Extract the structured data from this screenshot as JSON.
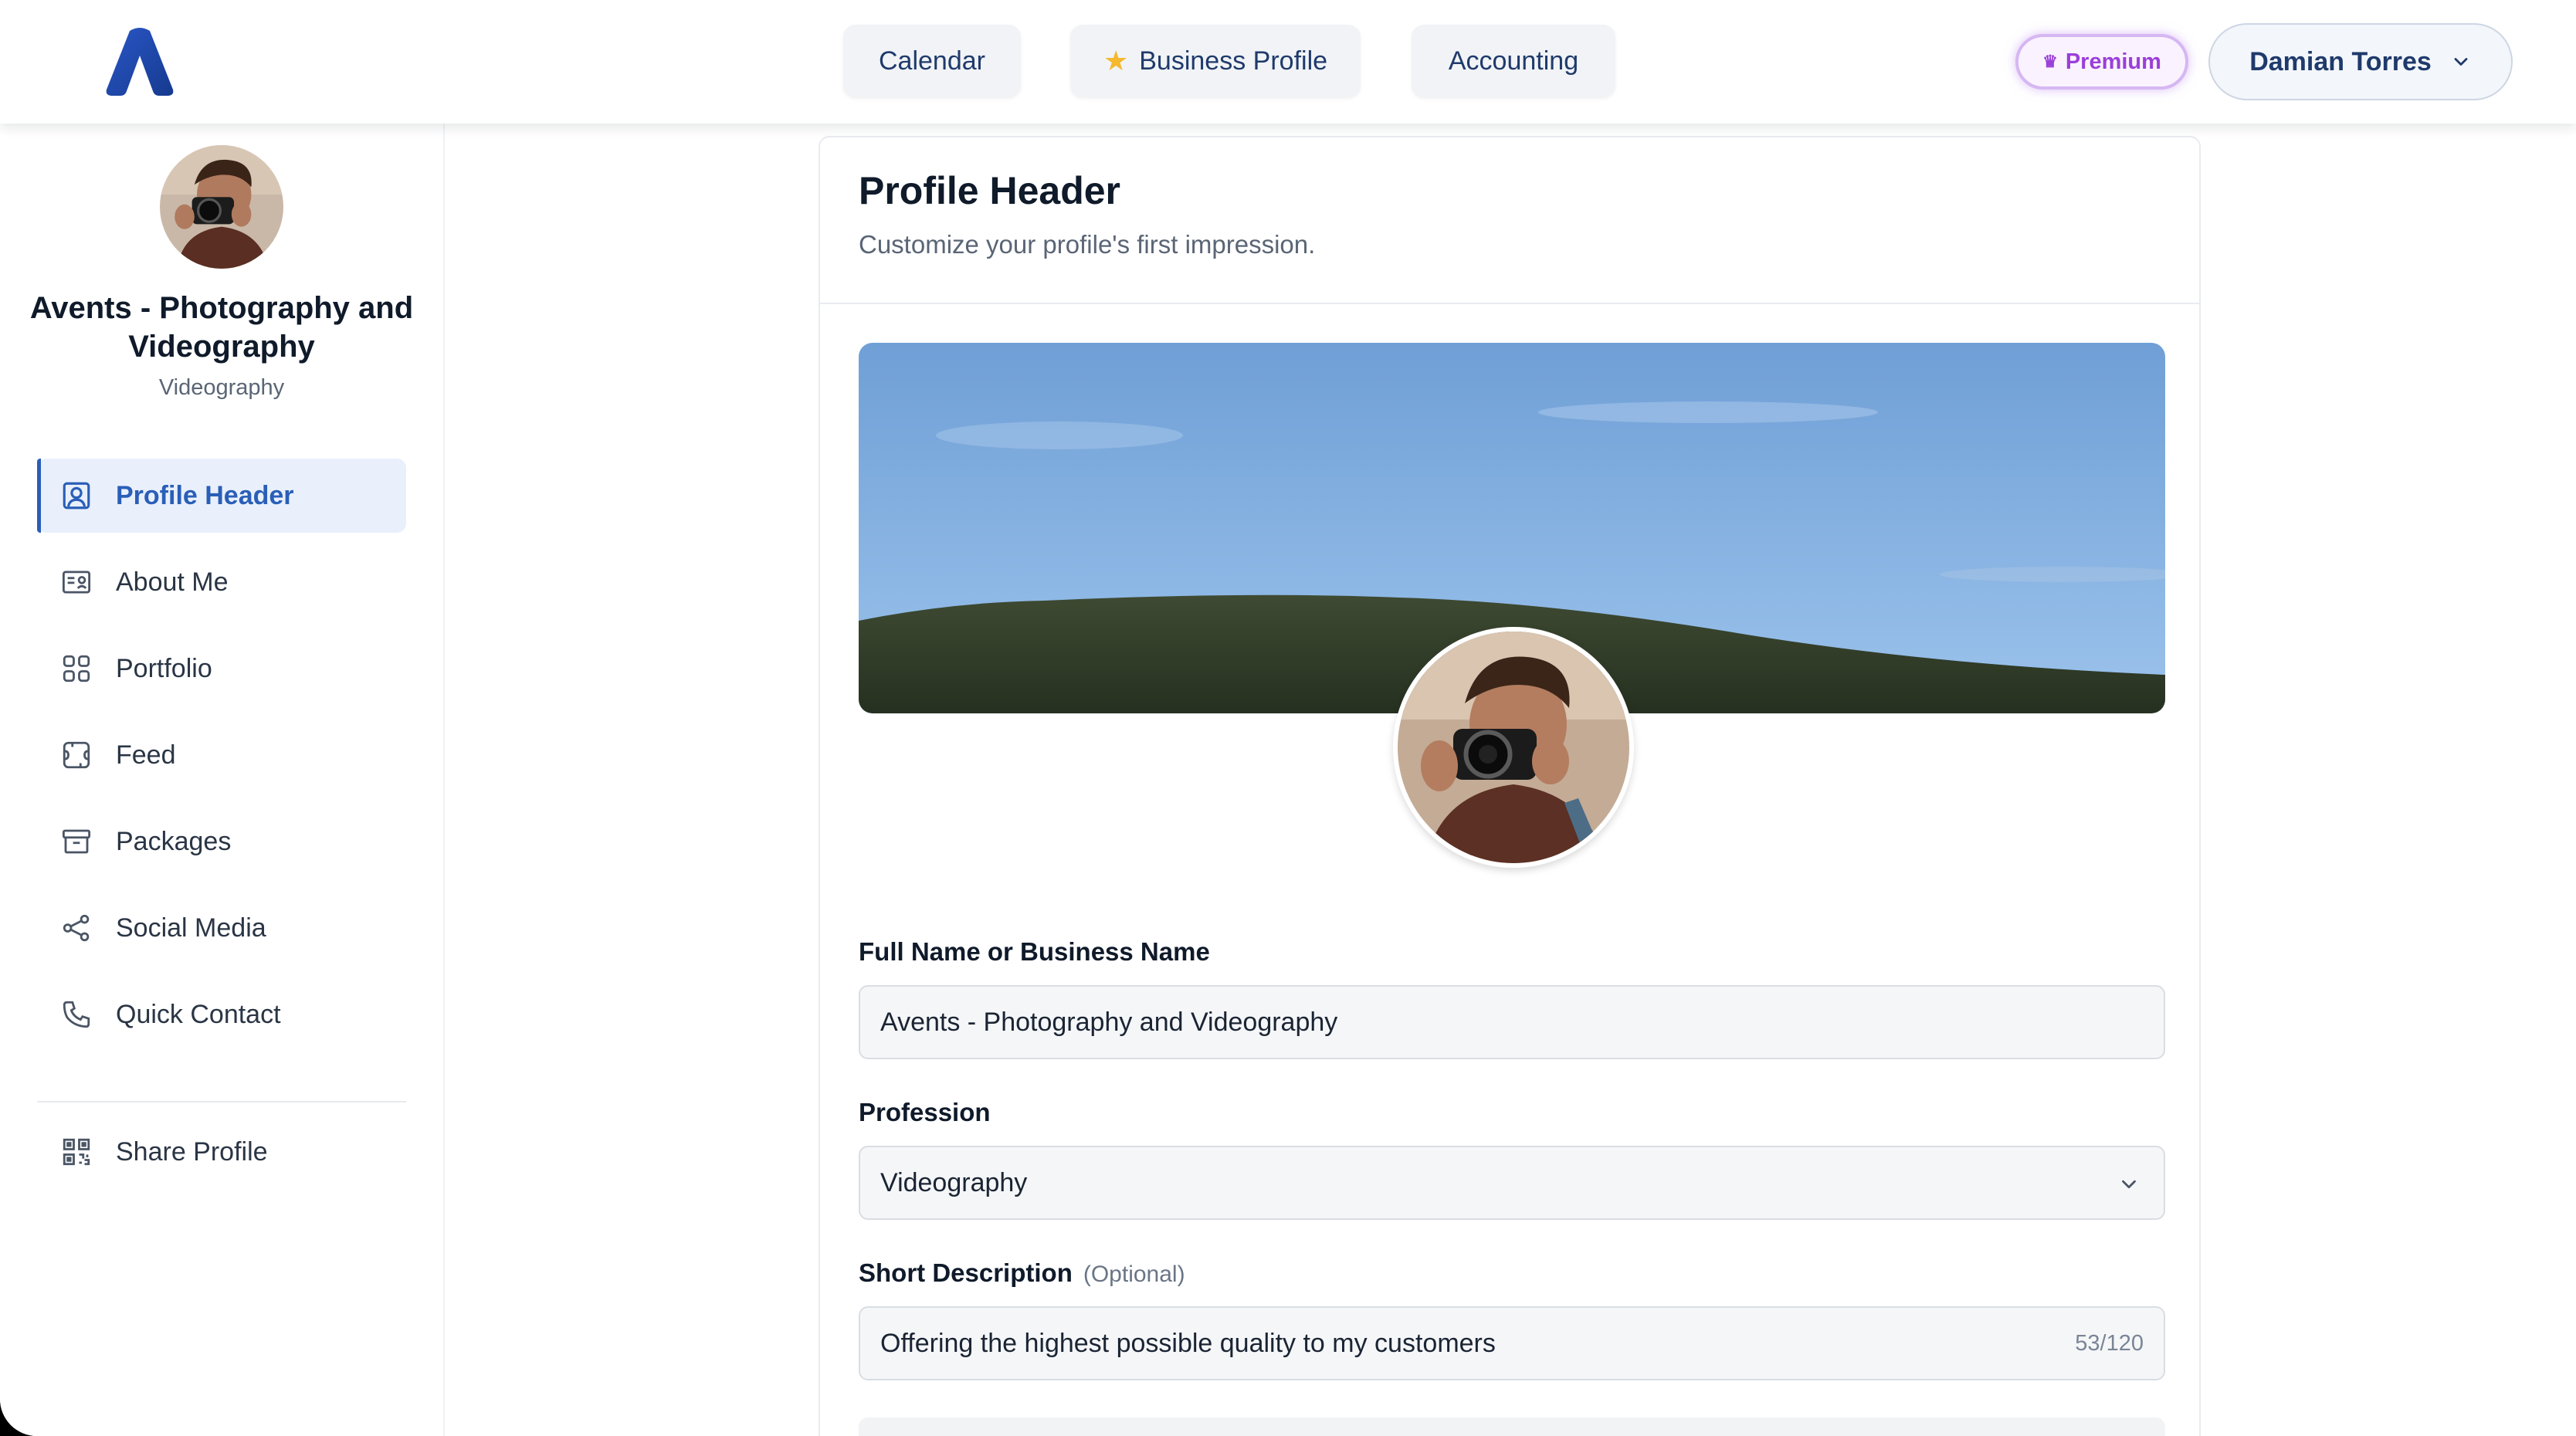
{
  "topbar": {
    "nav": [
      "Calendar",
      "Business Profile",
      "Accounting"
    ],
    "premium_label": "Premium",
    "user_name": "Damian Torres"
  },
  "sidebar": {
    "business_name": "Avents - Photography and Videography",
    "profession": "Videography",
    "items": [
      {
        "label": "Profile Header",
        "icon": "user-square-icon",
        "active": true
      },
      {
        "label": "About Me",
        "icon": "id-card-icon"
      },
      {
        "label": "Portfolio",
        "icon": "grid-icon"
      },
      {
        "label": "Feed",
        "icon": "feed-icon"
      },
      {
        "label": "Packages",
        "icon": "archive-box-icon"
      },
      {
        "label": "Social Media",
        "icon": "share-nodes-icon"
      },
      {
        "label": "Quick Contact",
        "icon": "phone-icon"
      }
    ],
    "share_label": "Share Profile"
  },
  "card": {
    "title": "Profile Header",
    "subtitle": "Customize your profile's first impression.",
    "fields": {
      "name_label": "Full Name or Business Name",
      "name_value": "Avents - Photography and Videography",
      "profession_label": "Profession",
      "profession_value": "Videography",
      "description_label": "Short Description",
      "description_optional": "(Optional)",
      "description_value": "Offering the highest possible quality to my customers",
      "description_count": "53/120"
    }
  },
  "colors": {
    "accent": "#2a5fb8",
    "nav_text": "#1f3a6b",
    "premium": "#9a3fd8",
    "star": "#f5b82e"
  }
}
